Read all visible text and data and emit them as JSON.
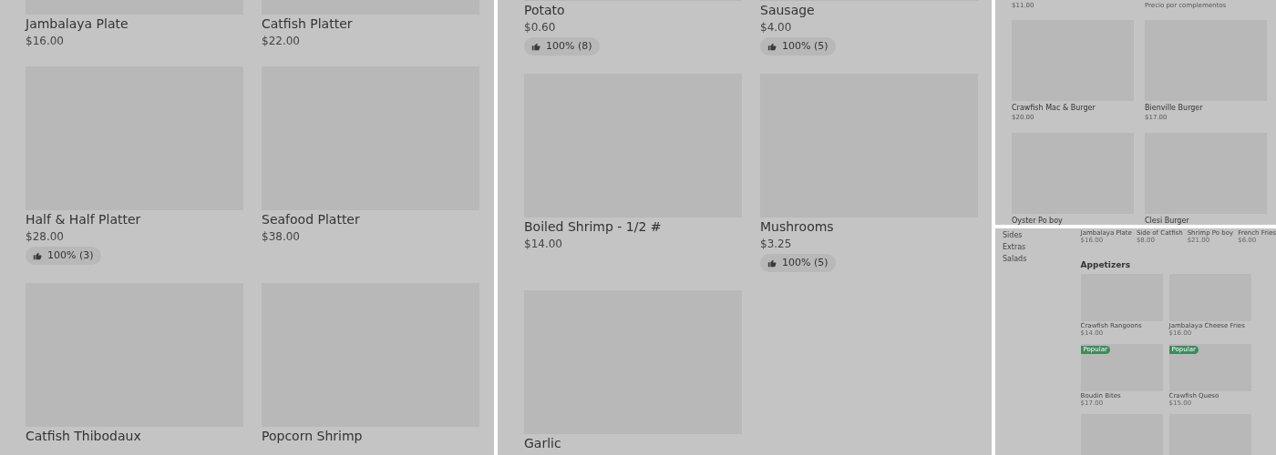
{
  "panels": [
    {
      "kind": "large",
      "cards": [
        {
          "name": "Jambalaya Plate",
          "price": "$16.00"
        },
        {
          "name": "Catfish Platter",
          "price": "$22.00"
        },
        {
          "name": "Half & Half Platter",
          "price": "$28.00",
          "rating": "100% (3)"
        },
        {
          "name": "Seafood Platter",
          "price": "$38.00"
        },
        {
          "name": "Catfish Thibodaux"
        },
        {
          "name": "Popcorn Shrimp"
        }
      ]
    },
    {
      "kind": "large",
      "cards": [
        {
          "name": "Potato",
          "price": "$0.60",
          "rating": "100% (8)"
        },
        {
          "name": "Sausage",
          "price": "$4.00",
          "rating": "100% (5)"
        },
        {
          "name": "Boiled Shrimp - 1/2 #",
          "price": "$14.00"
        },
        {
          "name": "Mushrooms",
          "price": "$3.25",
          "rating": "100% (5)"
        },
        {
          "name": "Garlic"
        }
      ]
    },
    {
      "kind": "medium",
      "top_prices": [
        "$11.00",
        "Precio por complementos"
      ],
      "cards": [
        {
          "name": "Crawfish Mac & Burger",
          "price": "$20.00"
        },
        {
          "name": "Bienville Burger",
          "price": "$17.00"
        },
        {
          "name": "Oyster Po boy"
        },
        {
          "name": "Clesi Burger"
        }
      ]
    },
    {
      "kind": "small",
      "sidebar": [
        "Sides",
        "Extras",
        "Salads"
      ],
      "top_items": [
        {
          "name": "Jambalaya Plate",
          "price": "$16.00"
        },
        {
          "name": "Side of Catfish",
          "price": "$8.00"
        },
        {
          "name": "Shrimp Po boy",
          "price": "$21.00"
        },
        {
          "name": "French Fries",
          "price": "$6.00"
        }
      ],
      "heading": "Appetizers",
      "cards": [
        {
          "kind": "item",
          "name": "Crawfish Rangoons",
          "price": "$14.00"
        },
        {
          "kind": "item",
          "name": "Jambalaya Cheese Fries",
          "price": "$16.00"
        },
        {
          "kind": "item",
          "name": "Boudin Bites",
          "price": "$17.00",
          "badge": "Popular"
        },
        {
          "kind": "item",
          "name": "Crawfish Queso",
          "price": "$15.00",
          "badge": "Popular"
        },
        {
          "kind": "image_only"
        },
        {
          "kind": "image_only"
        }
      ]
    }
  ]
}
